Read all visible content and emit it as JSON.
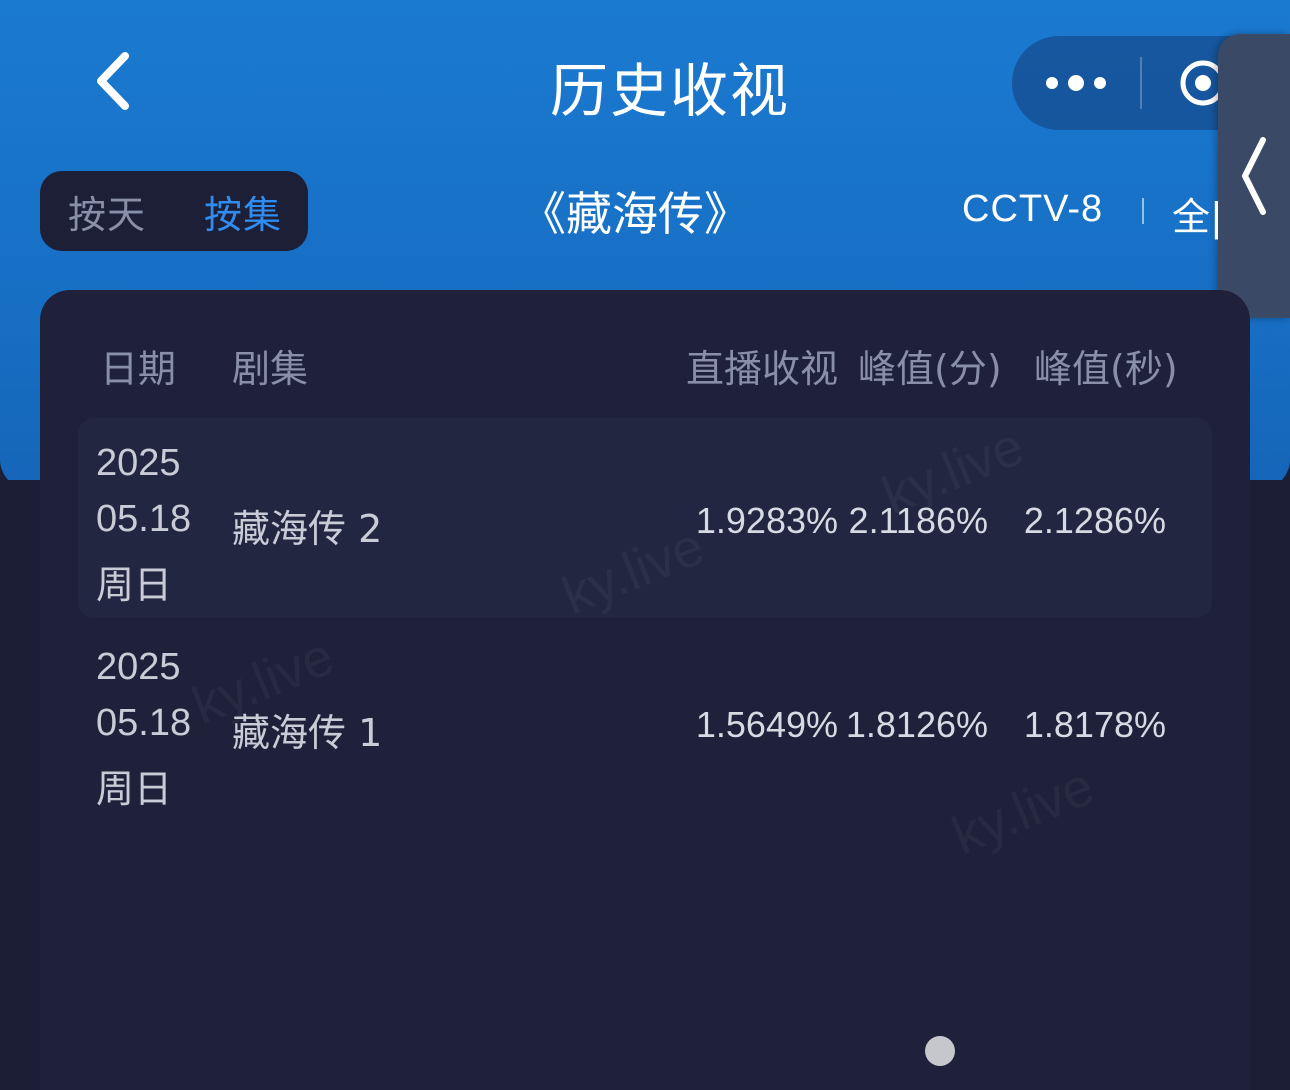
{
  "nav": {
    "title": "历史收视"
  },
  "toggle": {
    "by_day": "按天",
    "by_episode": "按集",
    "selected": "按集"
  },
  "show": {
    "title": "《藏海传》",
    "channel": "CCTV-8",
    "scope": "全|"
  },
  "table": {
    "headers": {
      "date": "日期",
      "episode": "剧集",
      "live": "直播收视",
      "peak_min": "峰值(分)",
      "peak_sec": "峰值(秒)"
    },
    "rows": [
      {
        "year": "2025",
        "date": "05.18",
        "weekday": "周日",
        "episode": "藏海传 2",
        "live": "1.9283%",
        "peak_min": "2.1186%",
        "peak_sec": "2.1286%"
      },
      {
        "year": "2025",
        "date": "05.18",
        "weekday": "周日",
        "episode": "藏海传 1",
        "live": "1.5649%",
        "peak_min": "1.8126%",
        "peak_sec": "1.8178%"
      }
    ]
  },
  "watermark": "ky.live",
  "icons": {
    "back": "chevron-left-icon",
    "more": "more-dots-icon",
    "target": "target-icon",
    "side": "chevron-left-icon"
  },
  "colors": {
    "header_blue": "#1a7ad0",
    "accent": "#2f8cf0",
    "background": "#1b1e35"
  }
}
